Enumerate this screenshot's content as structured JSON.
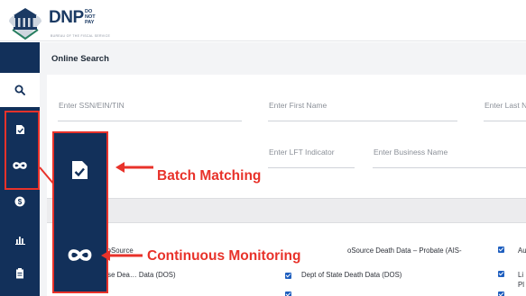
{
  "header": {
    "logo_text": "DNP",
    "logo_stack": [
      "DO",
      "NOT",
      "PAY"
    ],
    "tagline": "BUREAU OF THE FISCAL SERVICE"
  },
  "sidebar": {
    "items": [
      {
        "icon": "search-icon"
      },
      {
        "icon": "batch-document-icon"
      },
      {
        "icon": "infinity-icon"
      },
      {
        "icon": "dollar-icon"
      },
      {
        "icon": "bar-chart-icon"
      },
      {
        "icon": "report-icon"
      }
    ]
  },
  "main": {
    "title": "Online Search",
    "fields": {
      "ssn": "Enter SSN/EIN/TIN",
      "first_name": "Enter First Name",
      "last_name": "Enter Last N",
      "lft": "Enter LFT Indicator",
      "business": "Enter Business Name"
    },
    "section_label": "s",
    "list": [
      {
        "left": "InfoSource",
        "middle": "oSource Death Data – Probate (AIS-",
        "right": "Au"
      },
      {
        "left": "efense Dea… Data (DOS)",
        "middle": "Dept of State Death Data (DOS)",
        "right": "Li"
      },
      {
        "right_extra": "Pl"
      }
    ]
  },
  "annotations": {
    "batch": "Batch Matching",
    "continuous": "Continuous Monitoring"
  },
  "colors": {
    "navy": "#12305a",
    "highlight_red": "#e8322a",
    "checkbox_blue": "#1f5fbf"
  }
}
